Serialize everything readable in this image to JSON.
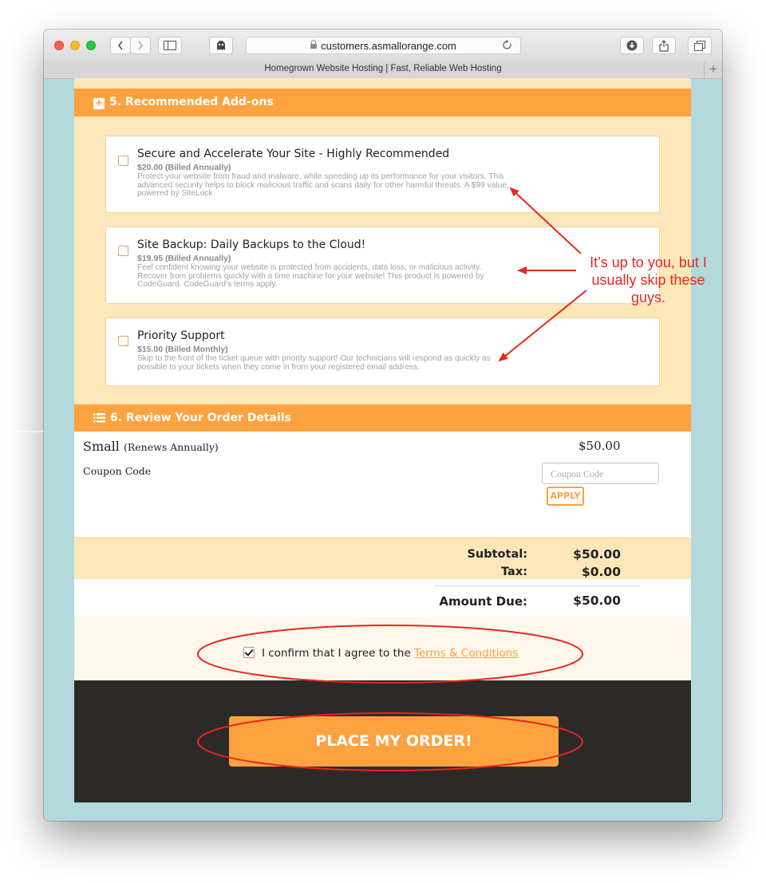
{
  "browser": {
    "url": "customers.asmallorange.com",
    "tab_title": "Homegrown Website Hosting | Fast, Reliable Web Hosting",
    "new_tab_glyph": "+",
    "icons": [
      "back-icon",
      "forward-icon",
      "sidebar-icon",
      "ghostery-icon",
      "lock-icon",
      "reload-icon",
      "download-icon",
      "share-icon",
      "tabs-icon"
    ]
  },
  "addons": {
    "header": "5. Recommended Add-ons",
    "items": [
      {
        "title": "Secure and Accelerate Your Site - Highly Recommended",
        "price": "$20.00 (Billed Annually)",
        "desc": "Protect your website from fraud and malware, while speeding up its performance for your visitors. This advanced security helps to block malicious traffic and scans daily for other harmful threats. A $99 value, powered by SiteLock."
      },
      {
        "title": "Site Backup: Daily Backups to the Cloud!",
        "price": "$19.95 (Billed Annually)",
        "desc": "Feel confident knowing your website is protected from accidents, data loss, or malicious activity. Recover from problems quickly with a time machine for your website! This product is powered by CodeGuard. CodeGuard's terms apply."
      },
      {
        "title": "Priority Support",
        "price": "$15.00 (Billed Monthly)",
        "desc": "Skip to the front of the ticket queue with priority support! Our technicians will respond as quickly as possible to your tickets when they come in from your registered email address."
      }
    ]
  },
  "annotation": "It’s up to you, but I usually skip these guys.",
  "review": {
    "header": "6. Review Your Order Details",
    "plan_name": "Small",
    "plan_renewal": "(Renews Annually)",
    "plan_price": "$50.00",
    "coupon_label": "Coupon Code",
    "coupon_placeholder": "Coupon Code",
    "apply_label": "APPLY"
  },
  "summary": {
    "subtotal_label": "Subtotal:",
    "subtotal": "$50.00",
    "tax_label": "Tax:",
    "tax": "$0.00",
    "due_label": "Amount Due:",
    "due": "$50.00"
  },
  "terms": {
    "text": "I confirm that I agree to the",
    "link": "Terms & Conditions",
    "checked": true
  },
  "order_button": "PLACE MY ORDER!",
  "colors": {
    "accent": "#fca23f",
    "cream": "#fde7b9",
    "annotation": "#e8271d",
    "dark": "#2c2a29"
  }
}
